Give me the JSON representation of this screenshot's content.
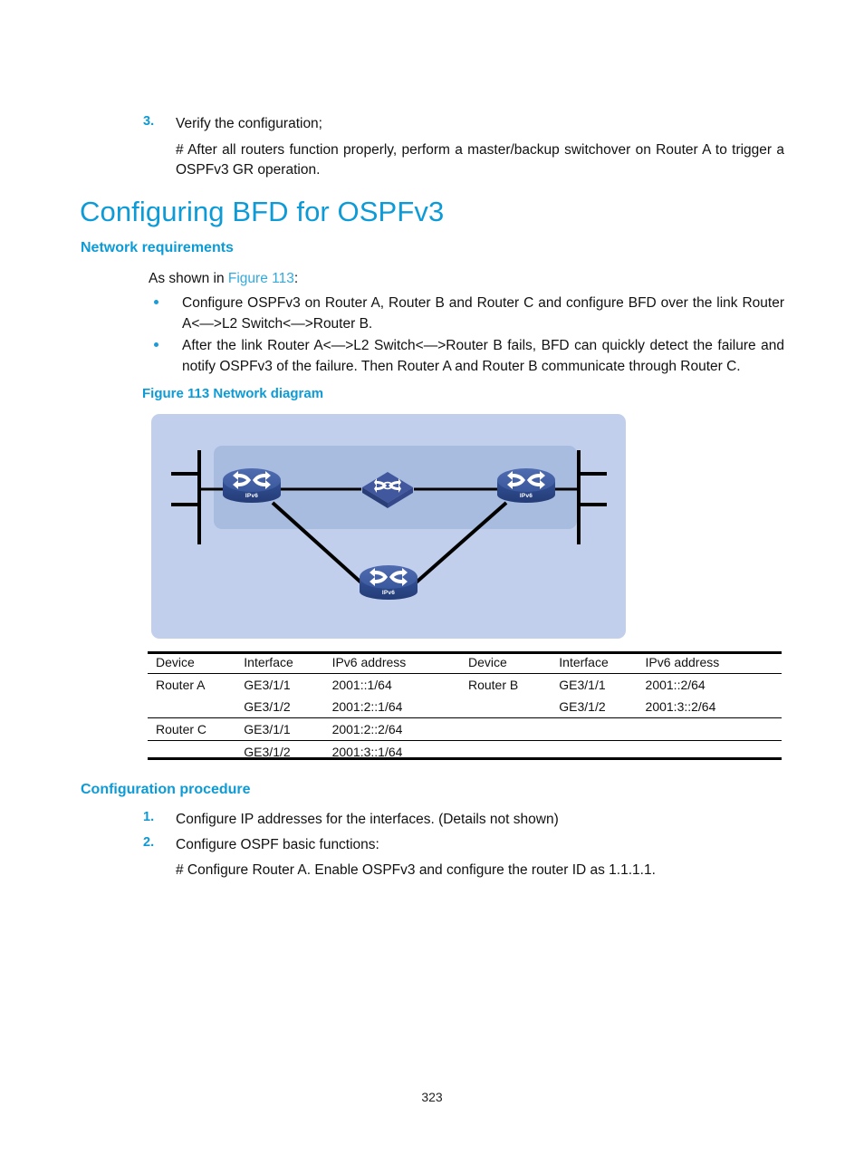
{
  "document": {
    "page_number": "323"
  },
  "top_list": {
    "items": [
      {
        "marker": "3.",
        "text": "Verify the configuration;"
      }
    ],
    "note": "# After all routers function properly, perform a master/backup switchover on Router A to trigger a OSPFv3 GR operation."
  },
  "section": {
    "title": "Configuring BFD for OSPFv3",
    "network_requirements": {
      "heading": "Network requirements",
      "intro_prefix": "As shown in ",
      "intro_link": "Figure 113",
      "intro_suffix": ":",
      "bullets": [
        "Configure OSPFv3 on Router A, Router B and Router C and configure BFD over the link Router A<—>L2 Switch<—>Router B.",
        "After the link Router A<—>L2 Switch<—>Router B fails, BFD can quickly detect the failure and notify OSPFv3 of the failure. Then Router A and Router B communicate through Router C."
      ]
    },
    "figure": {
      "caption": "Figure 113 Network diagram",
      "nodes": [
        {
          "id": "router-a",
          "type": "router",
          "label": "IPv6"
        },
        {
          "id": "l2-switch",
          "type": "switch",
          "label": ""
        },
        {
          "id": "router-b",
          "type": "router",
          "label": "IPv6"
        },
        {
          "id": "router-c",
          "type": "router",
          "label": "IPv6"
        }
      ],
      "colors": {
        "outer_region": "#c2cfec",
        "inner_region": "#a8bcdf",
        "device_fill": "#2f4b8c",
        "link": "#000000"
      }
    },
    "table": {
      "headers": [
        "Device",
        "Interface",
        "IPv6 address",
        "Device",
        "Interface",
        "IPv6 address"
      ],
      "rows": [
        [
          "Router A",
          "GE3/1/1",
          "2001::1/64",
          "Router B",
          "GE3/1/1",
          "2001::2/64"
        ],
        [
          "",
          "GE3/1/2",
          "2001:2::1/64",
          "",
          "GE3/1/2",
          "2001:3::2/64"
        ],
        [
          "Router C",
          "GE3/1/1",
          "2001:2::2/64",
          "",
          "",
          ""
        ],
        [
          "",
          "GE3/1/2",
          "2001:3::1/64",
          "",
          "",
          ""
        ]
      ]
    },
    "configuration_procedure": {
      "heading": "Configuration procedure",
      "steps": [
        {
          "marker": "1.",
          "text": "Configure IP addresses for the interfaces. (Details not shown)"
        },
        {
          "marker": "2.",
          "text": "Configure OSPF basic functions:"
        }
      ],
      "note": "# Configure Router A. Enable OSPFv3 and configure the router ID as 1.1.1.1."
    }
  }
}
